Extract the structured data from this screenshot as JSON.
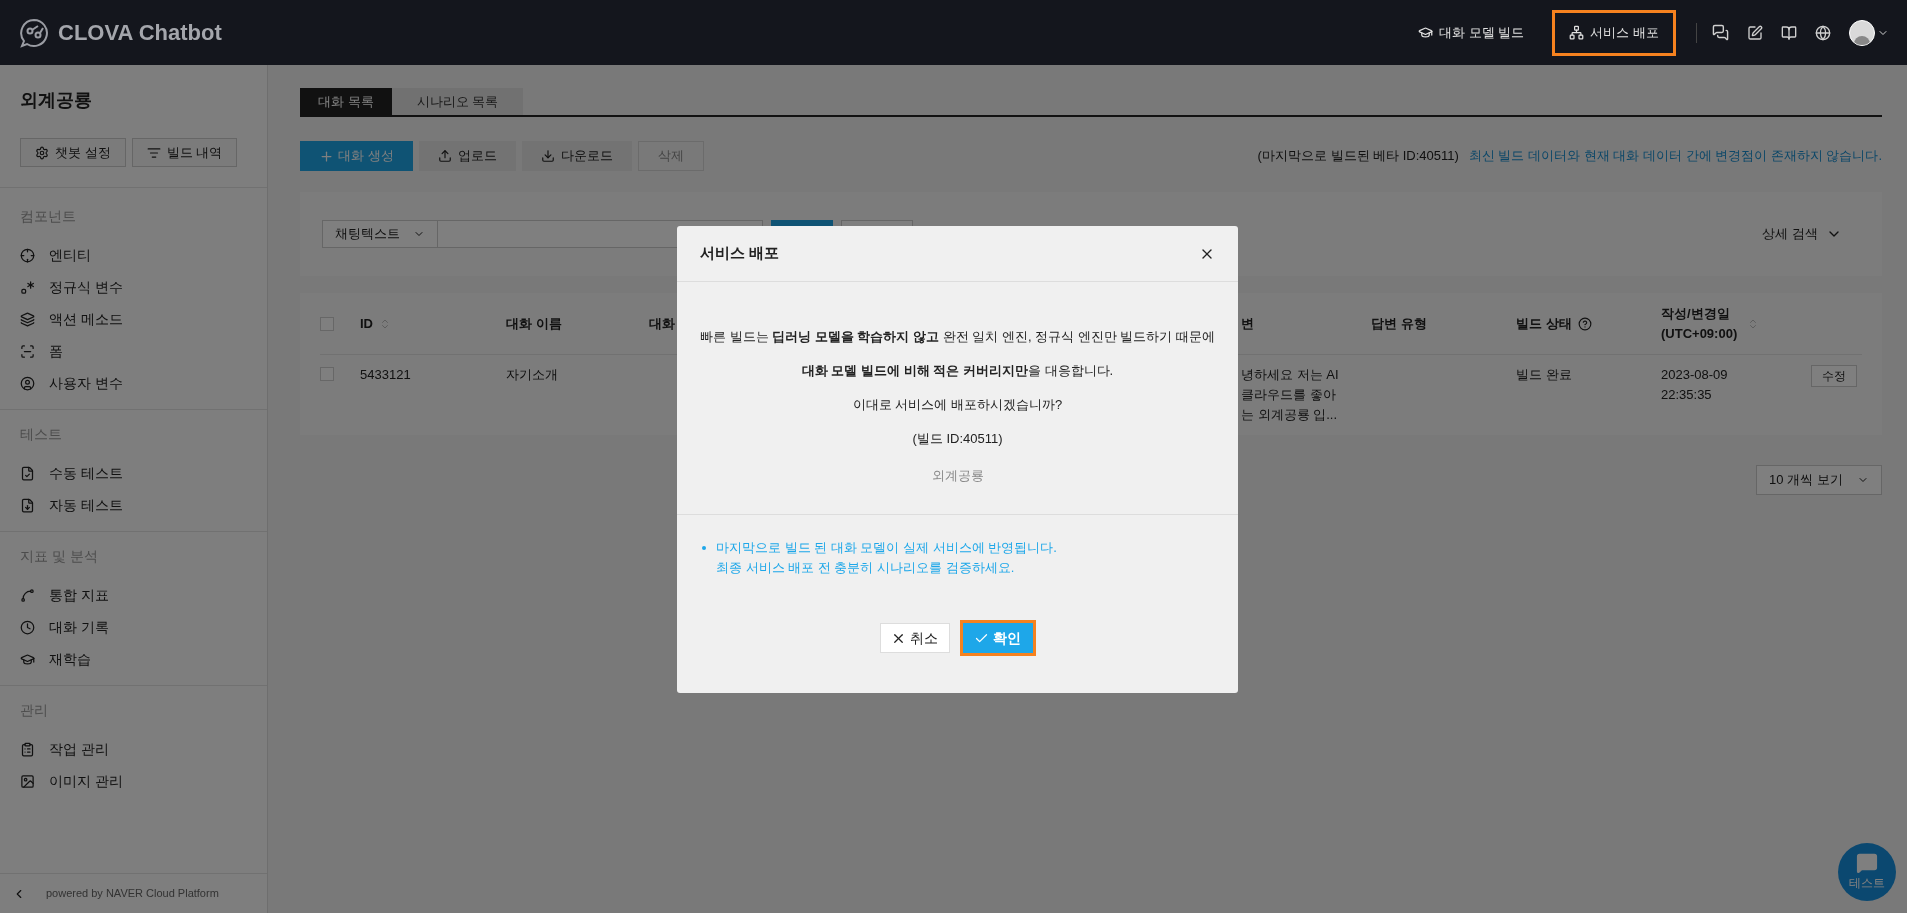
{
  "header": {
    "logo": "CLOVA Chatbot",
    "nav": [
      {
        "label": "대화 모델 빌드",
        "highlighted": false
      },
      {
        "label": "서비스 배포",
        "highlighted": true
      }
    ]
  },
  "sidebar": {
    "project": "외계공룡",
    "buttons": [
      "챗봇 설정",
      "빌드 내역"
    ],
    "sections": [
      {
        "title": "컴포넌트",
        "items": [
          "엔티티",
          "정규식 변수",
          "액션 메소드",
          "폼",
          "사용자 변수"
        ]
      },
      {
        "title": "테스트",
        "items": [
          "수동 테스트",
          "자동 테스트"
        ]
      },
      {
        "title": "지표 및 분석",
        "items": [
          "통합 지표",
          "대화 기록",
          "재학습"
        ]
      },
      {
        "title": "관리",
        "items": [
          "작업 관리",
          "이미지 관리"
        ]
      }
    ],
    "footer": "powered by NAVER Cloud Platform"
  },
  "tabs": [
    {
      "label": "대화 목록",
      "selected": true
    },
    {
      "label": "시나리오 목록",
      "selected": false
    }
  ],
  "toolbar": {
    "buttons": [
      {
        "label": "대화 생성",
        "kind": "primary"
      },
      {
        "label": "업로드",
        "kind": "upload"
      },
      {
        "label": "다운로드",
        "kind": "download"
      },
      {
        "label": "삭제",
        "kind": "disabled"
      }
    ],
    "build_note": "(마지막으로 빌드된 베타 ID:40511)",
    "build_status": "최신 빌드 데이터와 현재 대화 데이터 간에 변경점이 존재하지 않습니다."
  },
  "search": {
    "filter": "채팅텍스트",
    "advanced": "상세 검색"
  },
  "table": {
    "all_checked": false,
    "columns": [
      {
        "label": "ID",
        "sortable": true
      },
      {
        "label": "대화 이름"
      },
      {
        "label": "대화"
      },
      {
        "label": "변"
      },
      {
        "label": "답변 유형"
      },
      {
        "label": "빌드 상태",
        "help": true
      },
      {
        "label": "작성/변경일\n(UTC+09:00)",
        "sortable": true
      }
    ],
    "rows": [
      {
        "checked": false,
        "id": "5433121",
        "name": "자기소개",
        "answer": [
          "녕하세요 저는 AI",
          "클라우드를 좋아",
          "는 외계공룡 입..."
        ],
        "build_status": "빌드 완료",
        "date": "2023-08-09",
        "time": "22:35:35",
        "action": "수정"
      }
    ]
  },
  "page_size": "10 개씩 보기",
  "chat_button": "테스트",
  "modal": {
    "title": "서비스 배포",
    "message": "빠른 빌드는 **딥러닝 모델을 학습하지 않고** 완전 일치 엔진, 정규식 엔진만 빌드하기 때문에 **대화 모델 빌드에 비해 적은 커버리지만**을 대응합니다.",
    "question": "이대로 서비스에 배포하시겠습니까?",
    "build_id": "(빌드 ID:40511)",
    "project": "외계공룡",
    "notice": [
      "마지막으로 빌드 된 대화 모델이 실제 서비스에 반영됩니다.",
      "최종 서비스 배포 전 충분히 시나리오를 검증하세요."
    ],
    "buttons": [
      {
        "label": "취소",
        "kind": "cancel"
      },
      {
        "label": "확인",
        "kind": "confirm",
        "highlighted": true
      }
    ]
  }
}
